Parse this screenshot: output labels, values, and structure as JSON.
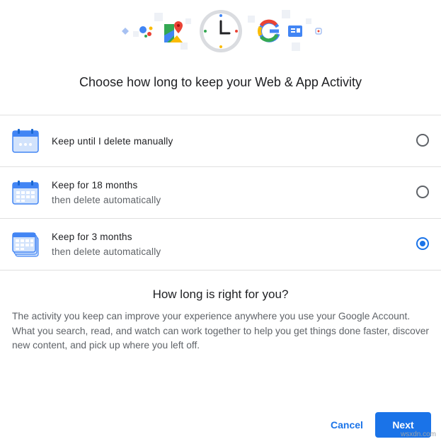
{
  "header": {
    "icons": [
      "assistant-tag-icon",
      "google-assistant-icon",
      "google-maps-icon",
      "clock-icon",
      "google-g-icon",
      "google-news-icon",
      "google-lens-icon"
    ],
    "title": "Choose how long to keep your Web & App Activity"
  },
  "options": [
    {
      "title": "Keep until I delete manually",
      "subtitle": "",
      "icon": "calendar-manual-icon",
      "selected": false
    },
    {
      "title": "Keep for 18 months",
      "subtitle": "then delete automatically",
      "icon": "calendar-18-months-icon",
      "selected": false
    },
    {
      "title": "Keep for 3 months",
      "subtitle": "then delete automatically",
      "icon": "calendar-3-months-icon",
      "selected": true
    }
  ],
  "info": {
    "heading": "How long is right for you?",
    "body": "The activity you keep can improve your experience anywhere you use your Google Account. What you search, read, and watch can work together to help you get things done faster, discover new content, and pick up where you left off."
  },
  "actions": {
    "cancel": "Cancel",
    "next": "Next"
  },
  "watermark": "wsxdn.com",
  "colors": {
    "accent": "#1a73e8",
    "text": "#202124",
    "secondary": "#5f6368",
    "divider": "#e0e0e0"
  }
}
